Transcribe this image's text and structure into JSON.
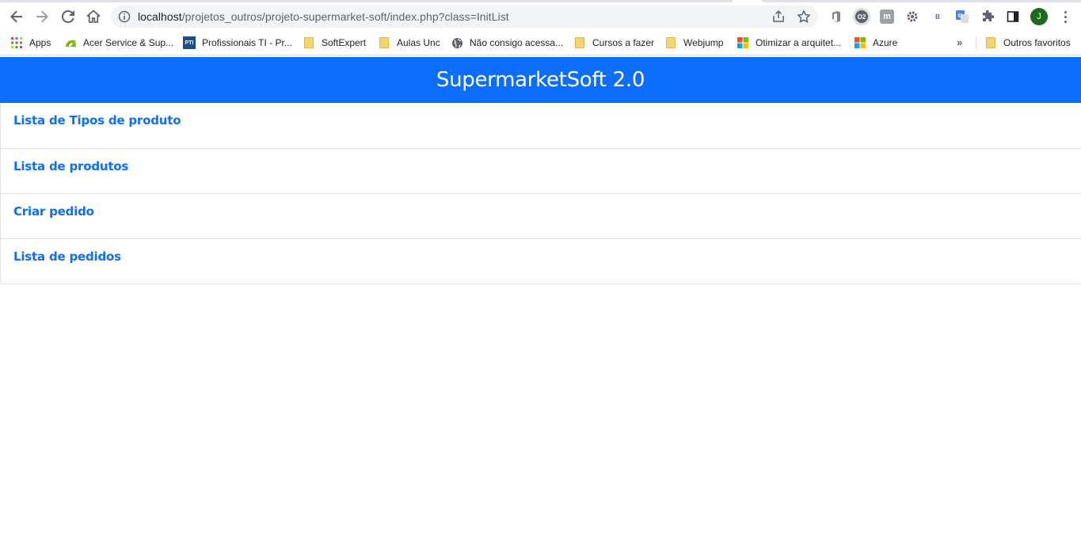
{
  "browser": {
    "url": {
      "host": "localhost",
      "path": "/projetos_outros/projeto-supermarket-soft/index.php?class=InitList"
    },
    "profile_initial": "J",
    "bookmarks": [
      {
        "label": "Apps",
        "icon": "apps-grid-icon"
      },
      {
        "label": "Acer Service & Sup...",
        "icon": "acer-icon"
      },
      {
        "label": "Profissionais TI - Pr...",
        "icon": "pti-icon",
        "icon_text": "PTI"
      },
      {
        "label": "SoftExpert",
        "icon": "folder-icon"
      },
      {
        "label": "Aulas Unc",
        "icon": "folder-icon"
      },
      {
        "label": "Não consigo acessa...",
        "icon": "globe-icon"
      },
      {
        "label": "Cursos a fazer",
        "icon": "folder-icon"
      },
      {
        "label": "Webjump",
        "icon": "folder-icon"
      },
      {
        "label": "Otimizar a arquitet...",
        "icon": "microsoft-icon"
      },
      {
        "label": "Azure",
        "icon": "microsoft-icon"
      }
    ],
    "other_bookmarks": "Outros favoritos",
    "extensions": {
      "badge_b": "B"
    }
  },
  "app": {
    "title": "SupermarketSoft 2.0",
    "menu": [
      {
        "label": "Lista de Tipos de produto"
      },
      {
        "label": "Lista de produtos"
      },
      {
        "label": "Criar pedido"
      },
      {
        "label": "Lista de pedidos"
      }
    ]
  },
  "colors": {
    "primary": "#0d6efd",
    "border": "#dee2e6"
  }
}
